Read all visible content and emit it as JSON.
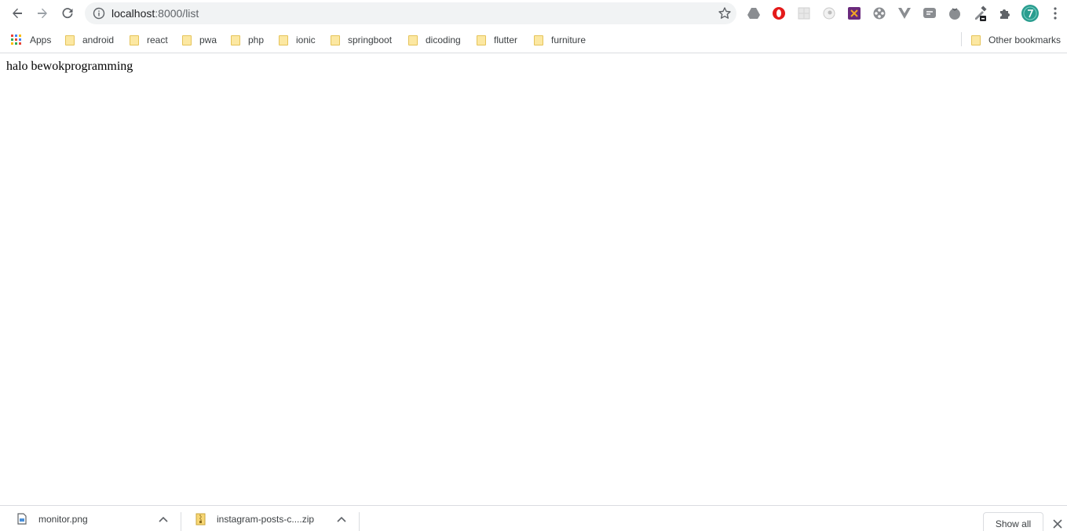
{
  "toolbar": {
    "url_host": "localhost",
    "url_path": ":8000/list",
    "icons": [
      "back-icon",
      "forward-icon",
      "reload-icon",
      "info-icon",
      "star-icon",
      "menu-icon"
    ]
  },
  "bookmarks": {
    "apps_label": "Apps",
    "folders": [
      "android",
      "react",
      "pwa",
      "php",
      "ionic",
      "springboot",
      "dicoding",
      "flutter",
      "furniture"
    ],
    "other_label": "Other bookmarks"
  },
  "page": {
    "text": "halo bewokprogramming"
  },
  "downloads": {
    "items": [
      "monitor.png",
      "instagram-posts-c....zip"
    ],
    "show_all_label": "Show all"
  },
  "colors": {
    "avatar": "#2a9d8f",
    "opera": "#e41a1a",
    "folder": "#fce8a2"
  }
}
